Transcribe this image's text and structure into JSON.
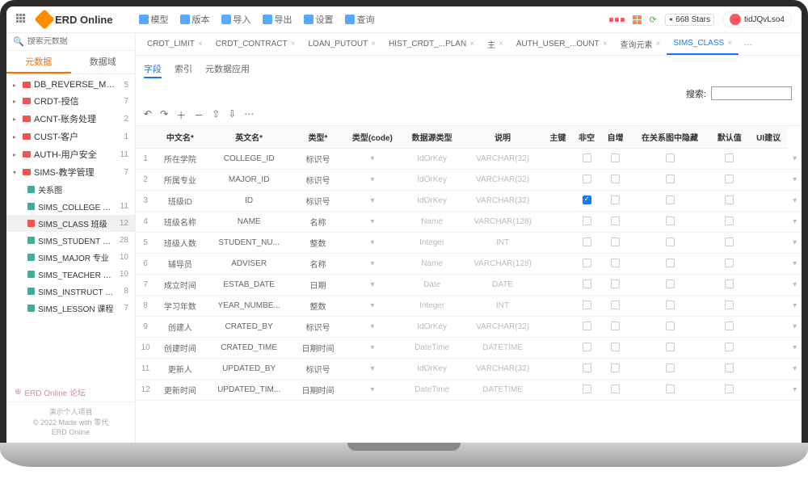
{
  "app": {
    "name": "ERD Online"
  },
  "topmenu": [
    {
      "label": "模型",
      "icon": "model"
    },
    {
      "label": "版本",
      "icon": "version"
    },
    {
      "label": "导入",
      "icon": "import"
    },
    {
      "label": "导出",
      "icon": "export"
    },
    {
      "label": "设置",
      "icon": "settings"
    },
    {
      "label": "查询",
      "icon": "query"
    }
  ],
  "github": {
    "stars": "668 Stars"
  },
  "user": {
    "name": "tidJQvLso4"
  },
  "sidebar": {
    "search_placeholder": "搜索元数据",
    "tabs": [
      "元数据",
      "数据域"
    ],
    "active_tab": 0,
    "groups": [
      {
        "name": "DB_REVERSE_MYSQL ...",
        "count": 5,
        "expanded": false
      },
      {
        "name": "CRDT-授信",
        "count": 7,
        "expanded": false
      },
      {
        "name": "ACNT-账务处理",
        "count": 2,
        "expanded": false
      },
      {
        "name": "CUST-客户",
        "count": 1,
        "expanded": false
      },
      {
        "name": "AUTH-用户安全",
        "count": 11,
        "expanded": false
      },
      {
        "name": "SIMS-教学管理",
        "count": 7,
        "expanded": true,
        "children": [
          {
            "name": "关系图",
            "count": "",
            "icon": "rel"
          },
          {
            "name": "SIMS_COLLEGE 学院",
            "count": 11
          },
          {
            "name": "SIMS_CLASS 班级",
            "count": 12,
            "selected": true
          },
          {
            "name": "SIMS_STUDENT 学生",
            "count": 28
          },
          {
            "name": "SIMS_MAJOR 专业",
            "count": 10
          },
          {
            "name": "SIMS_TEACHER 教师",
            "count": 10
          },
          {
            "name": "SIMS_INSTRUCT 授课",
            "count": 8
          },
          {
            "name": "SIMS_LESSON 课程",
            "count": 7
          }
        ]
      }
    ],
    "forum": "ERD Online 论坛",
    "footer": [
      "演示个人项目",
      "© 2022 Made with 零代",
      "ERD Online"
    ]
  },
  "tabs": [
    {
      "label": "CRDT_LIMIT"
    },
    {
      "label": "CRDT_CONTRACT"
    },
    {
      "label": "LOAN_PUTOUT"
    },
    {
      "label": "HIST_CRDT_...PLAN"
    },
    {
      "label": "主"
    },
    {
      "label": "AUTH_USER_...OUNT"
    },
    {
      "label": "查询元素"
    },
    {
      "label": "SIMS_CLASS",
      "active": true
    }
  ],
  "subtabs": {
    "items": [
      "字段",
      "索引",
      "元数据应用"
    ],
    "active": 0
  },
  "search": {
    "label": "搜索:"
  },
  "grid": {
    "headers": [
      "",
      "中文名*",
      "英文名*",
      "类型*",
      "类型(code)",
      "数据源类型",
      "说明",
      "主键",
      "非空",
      "自增",
      "在关系图中隐藏",
      "默认值",
      "UI建议"
    ],
    "rows": [
      {
        "idx": 1,
        "cn": "所在学院",
        "en": "COLLEGE_ID",
        "type": "标识号",
        "code": "IdOrKey",
        "dstype": "VARCHAR(32)",
        "pk": false
      },
      {
        "idx": 2,
        "cn": "所属专业",
        "en": "MAJOR_ID",
        "type": "标识号",
        "code": "IdOrKey",
        "dstype": "VARCHAR(32)",
        "pk": false
      },
      {
        "idx": 3,
        "cn": "班级ID",
        "en": "ID",
        "type": "标识号",
        "code": "IdOrKey",
        "dstype": "VARCHAR(32)",
        "pk": true
      },
      {
        "idx": 4,
        "cn": "班级名称",
        "en": "NAME",
        "type": "名称",
        "code": "Name",
        "dstype": "VARCHAR(128)",
        "pk": false
      },
      {
        "idx": 5,
        "cn": "班级人数",
        "en": "STUDENT_NU...",
        "type": "整数",
        "code": "Integer",
        "dstype": "INT",
        "pk": false
      },
      {
        "idx": 6,
        "cn": "辅导员",
        "en": "ADVISER",
        "type": "名称",
        "code": "Name",
        "dstype": "VARCHAR(128)",
        "pk": false
      },
      {
        "idx": 7,
        "cn": "成立时间",
        "en": "ESTAB_DATE",
        "type": "日期",
        "code": "Date",
        "dstype": "DATE",
        "pk": false
      },
      {
        "idx": 8,
        "cn": "学习年数",
        "en": "YEAR_NUMBE...",
        "type": "整数",
        "code": "Integer",
        "dstype": "INT",
        "pk": false
      },
      {
        "idx": 9,
        "cn": "创建人",
        "en": "CRATED_BY",
        "type": "标识号",
        "code": "IdOrKey",
        "dstype": "VARCHAR(32)",
        "pk": false
      },
      {
        "idx": 10,
        "cn": "创建时间",
        "en": "CRATED_TIME",
        "type": "日期时间",
        "code": "DateTime",
        "dstype": "DATETIME",
        "pk": false
      },
      {
        "idx": 11,
        "cn": "更新人",
        "en": "UPDATED_BY",
        "type": "标识号",
        "code": "IdOrKey",
        "dstype": "VARCHAR(32)",
        "pk": false
      },
      {
        "idx": 12,
        "cn": "更新时间",
        "en": "UPDATED_TIM...",
        "type": "日期时间",
        "code": "DateTime",
        "dstype": "DATETIME",
        "pk": false
      }
    ]
  },
  "more_indicator": "…"
}
